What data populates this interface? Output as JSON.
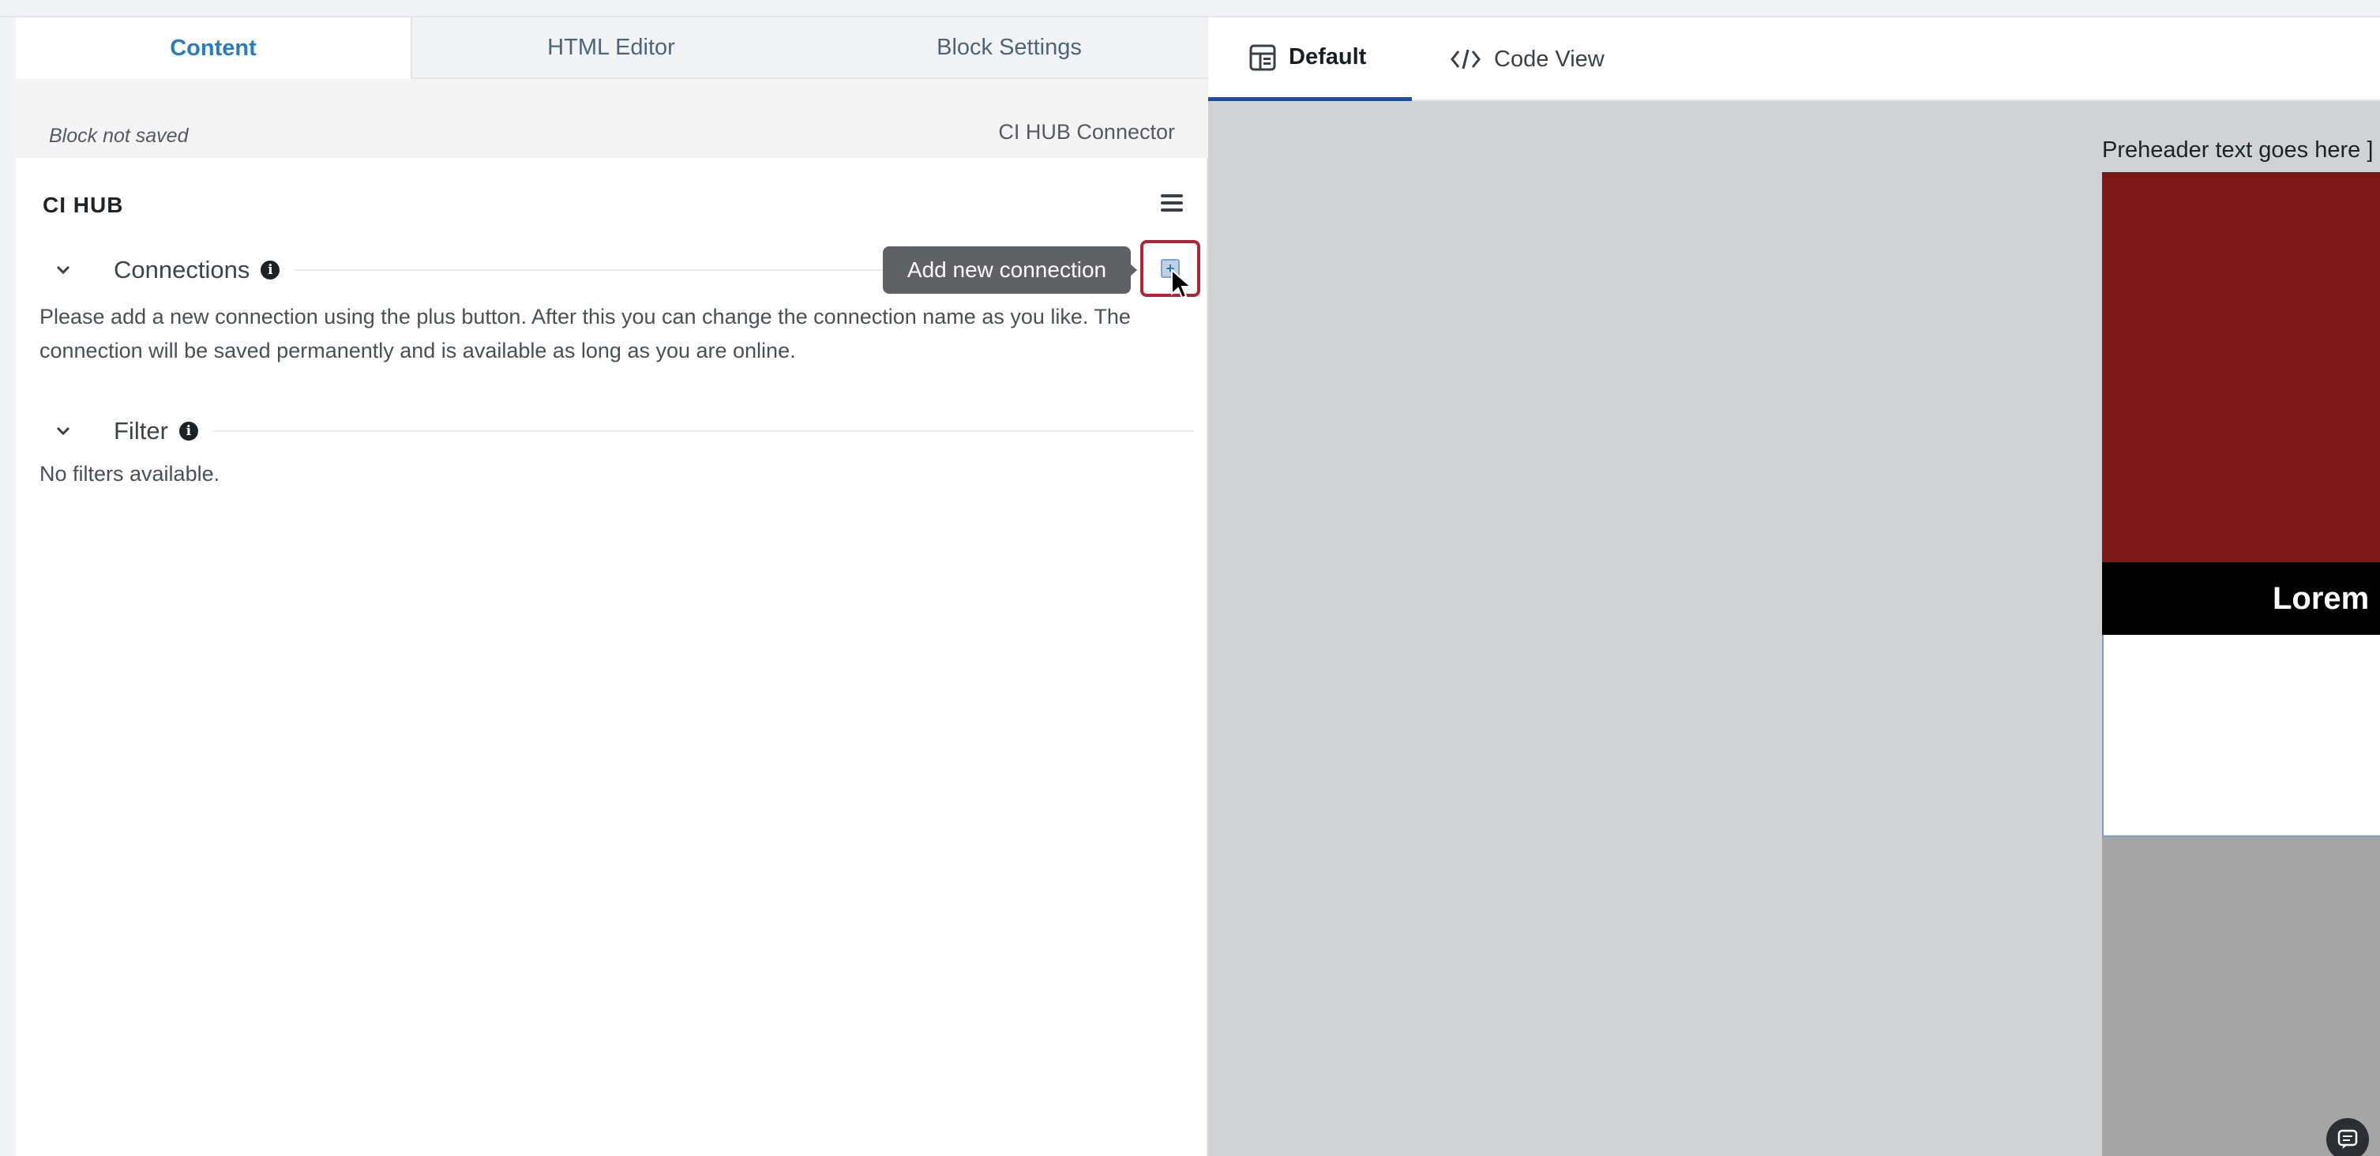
{
  "left_panel": {
    "tabs": [
      {
        "label": "Content",
        "active": true
      },
      {
        "label": "HTML Editor",
        "active": false
      },
      {
        "label": "Block Settings",
        "active": false
      }
    ],
    "status": "Block not saved",
    "connector_name": "CI HUB Connector",
    "app_title": "CI HUB",
    "connections": {
      "title": "Connections",
      "description": "Please add a new connection using the plus button. After this you can change the connection name as you like. The connection will be saved permanently and is available as long as you are online.",
      "add_tooltip": "Add new connection"
    },
    "filter": {
      "title": "Filter",
      "empty_text": "No filters available."
    }
  },
  "right_panel": {
    "view_tabs": [
      {
        "label": "Default",
        "icon": "layout-icon",
        "active": true
      },
      {
        "label": "Code View",
        "icon": "code-icon",
        "active": false
      }
    ],
    "preview": {
      "preheader": "Preheader text goes here ]",
      "title_bar": "Lorem i"
    }
  },
  "colors": {
    "accent": "#2a7ac0",
    "active_underline": "#1c4fa3",
    "highlight_border": "#b3243a",
    "hero_red": "#7b1916",
    "canvas_gray": "#d1d2d4"
  }
}
